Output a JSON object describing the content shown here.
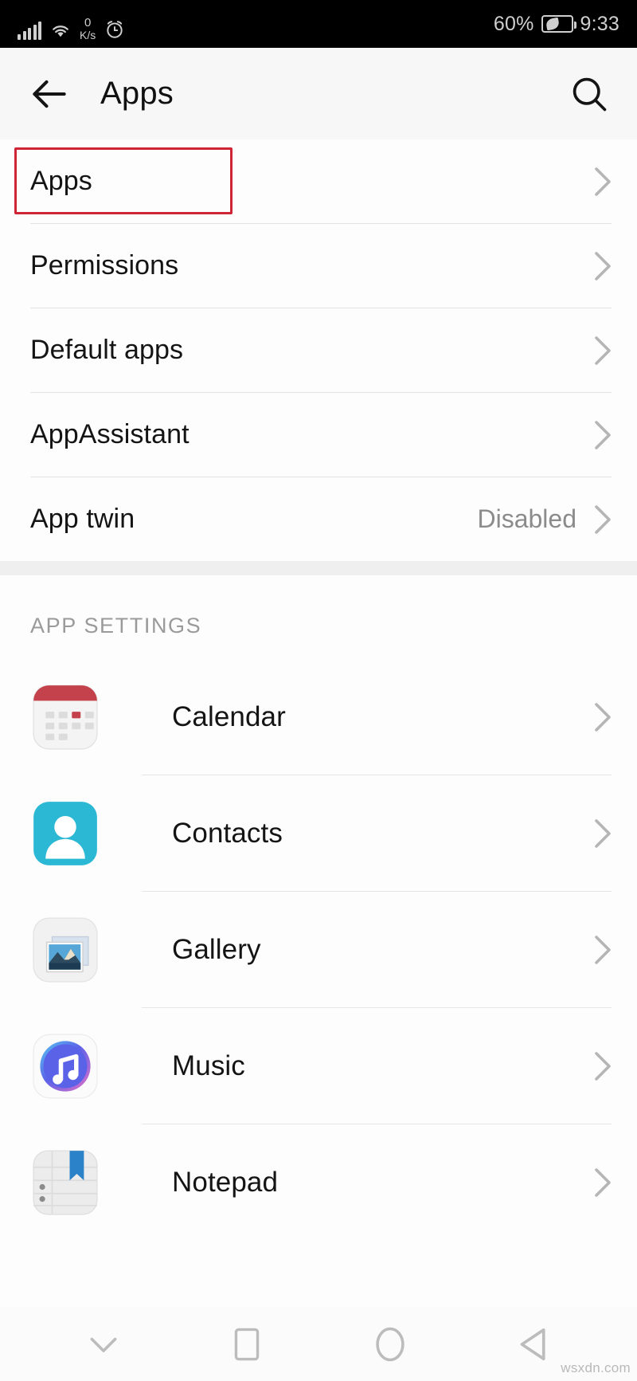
{
  "status_bar": {
    "signal_icon": "cellular-signal-icon",
    "wifi_icon": "wifi-icon",
    "network_speed_value": "0",
    "network_speed_unit": "K/s",
    "alarm_icon": "alarm-clock-icon",
    "battery_percent": "60%",
    "battery_icon": "battery-power-saving-icon",
    "time": "9:33",
    "background_color": "#000000",
    "text_color": "#cfcfcf"
  },
  "app_bar": {
    "back_icon": "back-arrow-icon",
    "title": "Apps",
    "search_icon": "search-icon",
    "background_color": "#f7f7f7"
  },
  "annotation": {
    "highlight_color": "#cf2436",
    "target": "Apps"
  },
  "settings_list": [
    {
      "label": "Apps",
      "value": "",
      "chevron": "chevron-right-icon",
      "highlighted": true
    },
    {
      "label": "Permissions",
      "value": "",
      "chevron": "chevron-right-icon",
      "highlighted": false
    },
    {
      "label": "Default apps",
      "value": "",
      "chevron": "chevron-right-icon",
      "highlighted": false
    },
    {
      "label": "AppAssistant",
      "value": "",
      "chevron": "chevron-right-icon",
      "highlighted": false
    },
    {
      "label": "App twin",
      "value": "Disabled",
      "chevron": "chevron-right-icon",
      "highlighted": false
    }
  ],
  "app_settings": {
    "group_header": "APP SETTINGS",
    "items": [
      {
        "label": "Calendar",
        "icon": "calendar-app-icon",
        "chevron": "chevron-right-icon"
      },
      {
        "label": "Contacts",
        "icon": "contacts-app-icon",
        "chevron": "chevron-right-icon"
      },
      {
        "label": "Gallery",
        "icon": "gallery-app-icon",
        "chevron": "chevron-right-icon"
      },
      {
        "label": "Music",
        "icon": "music-app-icon",
        "chevron": "chevron-right-icon"
      },
      {
        "label": "Notepad",
        "icon": "notepad-app-icon",
        "chevron": "chevron-right-icon"
      }
    ]
  },
  "nav_bar": {
    "buttons": [
      {
        "name": "hide-navbar-button",
        "icon": "chevron-down-icon"
      },
      {
        "name": "recents-button",
        "icon": "square-icon"
      },
      {
        "name": "home-button",
        "icon": "circle-icon"
      },
      {
        "name": "back-button",
        "icon": "triangle-left-icon"
      }
    ]
  },
  "watermark": "wsxdn.com"
}
